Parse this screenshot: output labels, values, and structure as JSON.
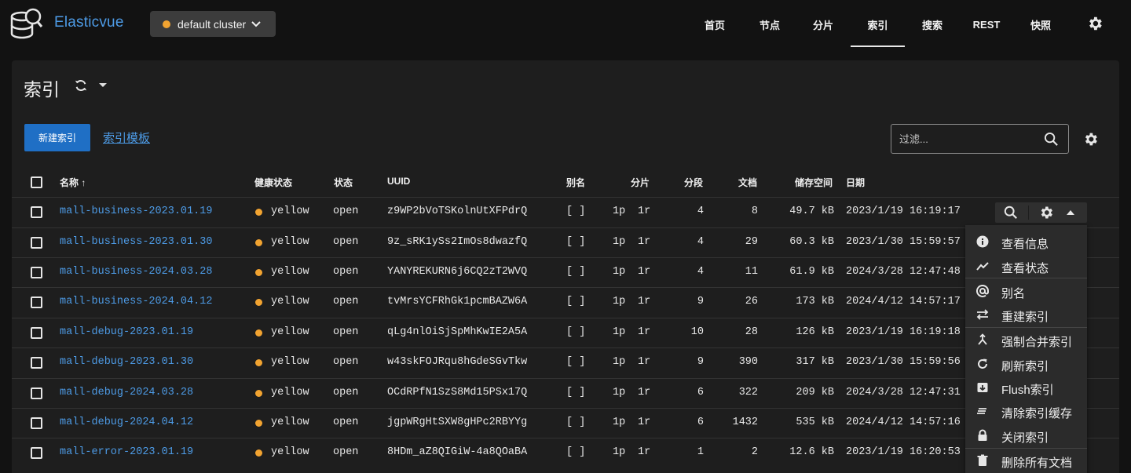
{
  "app": {
    "brand": "Elasticvue",
    "cluster_label": "default cluster",
    "cluster_status_color": "#f2a431",
    "accent": "#4d9be6"
  },
  "nav": [
    {
      "label": "首页",
      "active": false
    },
    {
      "label": "节点",
      "active": false
    },
    {
      "label": "分片",
      "active": false
    },
    {
      "label": "索引",
      "active": true
    },
    {
      "label": "搜索",
      "active": false
    },
    {
      "label": "REST",
      "active": false
    },
    {
      "label": "快照",
      "active": false
    }
  ],
  "page": {
    "title": "索引",
    "new_index_label": "新建索引",
    "templates_label": "索引模板",
    "filter_placeholder": "过滤..."
  },
  "table": {
    "headers": {
      "name": "名称",
      "health": "健康状态",
      "status": "状态",
      "uuid": "UUID",
      "aliases": "别名",
      "shards": "分片",
      "segments": "分段",
      "docs": "文档",
      "storage": "储存空间",
      "date": "日期"
    },
    "sort_indicator": "↑",
    "rows": [
      {
        "name": "mall-business-2023.01.19",
        "health": "yellow",
        "status": "open",
        "uuid": "z9WP2bVoTSKolnUtXFPdrQ",
        "aliases": "[ ]",
        "primary": "1p",
        "replica": "1r",
        "segments": "4",
        "docs": "8",
        "storage": "49.7 kB",
        "date": "2023/1/19 16:19:17"
      },
      {
        "name": "mall-business-2023.01.30",
        "health": "yellow",
        "status": "open",
        "uuid": "9z_sRK1ySs2ImOs8dwazfQ",
        "aliases": "[ ]",
        "primary": "1p",
        "replica": "1r",
        "segments": "4",
        "docs": "29",
        "storage": "60.3 kB",
        "date": "2023/1/30 15:59:57"
      },
      {
        "name": "mall-business-2024.03.28",
        "health": "yellow",
        "status": "open",
        "uuid": "YANYREKURN6j6CQ2zT2WVQ",
        "aliases": "[ ]",
        "primary": "1p",
        "replica": "1r",
        "segments": "4",
        "docs": "11",
        "storage": "61.9 kB",
        "date": "2024/3/28 12:47:48"
      },
      {
        "name": "mall-business-2024.04.12",
        "health": "yellow",
        "status": "open",
        "uuid": "tvMrsYCFRhGk1pcmBAZW6A",
        "aliases": "[ ]",
        "primary": "1p",
        "replica": "1r",
        "segments": "9",
        "docs": "26",
        "storage": "173 kB",
        "date": "2024/4/12 14:57:17"
      },
      {
        "name": "mall-debug-2023.01.19",
        "health": "yellow",
        "status": "open",
        "uuid": "qLg4nlOiSjSpMhKwIE2A5A",
        "aliases": "[ ]",
        "primary": "1p",
        "replica": "1r",
        "segments": "10",
        "docs": "28",
        "storage": "126 kB",
        "date": "2023/1/19 16:19:18"
      },
      {
        "name": "mall-debug-2023.01.30",
        "health": "yellow",
        "status": "open",
        "uuid": "w43skFOJRqu8hGdeSGvTkw",
        "aliases": "[ ]",
        "primary": "1p",
        "replica": "1r",
        "segments": "9",
        "docs": "390",
        "storage": "317 kB",
        "date": "2023/1/30 15:59:56"
      },
      {
        "name": "mall-debug-2024.03.28",
        "health": "yellow",
        "status": "open",
        "uuid": "OCdRPfN1SzS8Md15PSx17Q",
        "aliases": "[ ]",
        "primary": "1p",
        "replica": "1r",
        "segments": "6",
        "docs": "322",
        "storage": "209 kB",
        "date": "2024/3/28 12:47:31"
      },
      {
        "name": "mall-debug-2024.04.12",
        "health": "yellow",
        "status": "open",
        "uuid": "jgpWRgHtSXW8gHPc2RBYYg",
        "aliases": "[ ]",
        "primary": "1p",
        "replica": "1r",
        "segments": "6",
        "docs": "1432",
        "storage": "535 kB",
        "date": "2024/4/12 14:57:16"
      },
      {
        "name": "mall-error-2023.01.19",
        "health": "yellow",
        "status": "open",
        "uuid": "8HDm_aZ8QIGiW-4a8QOaBA",
        "aliases": "[ ]",
        "primary": "1p",
        "replica": "1r",
        "segments": "1",
        "docs": "2",
        "storage": "12.6 kB",
        "date": "2023/1/19 16:20:53"
      }
    ]
  },
  "menu": [
    {
      "label": "查看信息",
      "icon": "info-icon"
    },
    {
      "label": "查看状态",
      "icon": "chart-line-icon"
    },
    {
      "label": "别名",
      "icon": "at-icon"
    },
    {
      "label": "重建索引",
      "icon": "swap-icon"
    },
    {
      "label": "强制合并索引",
      "icon": "merge-icon"
    },
    {
      "label": "刷新索引",
      "icon": "refresh-icon"
    },
    {
      "label": "Flush索引",
      "icon": "archive-icon"
    },
    {
      "label": "清除索引缓存",
      "icon": "clear-icon"
    },
    {
      "label": "关闭索引",
      "icon": "lock-icon"
    },
    {
      "label": "删除所有文档",
      "icon": "trash-icon"
    }
  ]
}
